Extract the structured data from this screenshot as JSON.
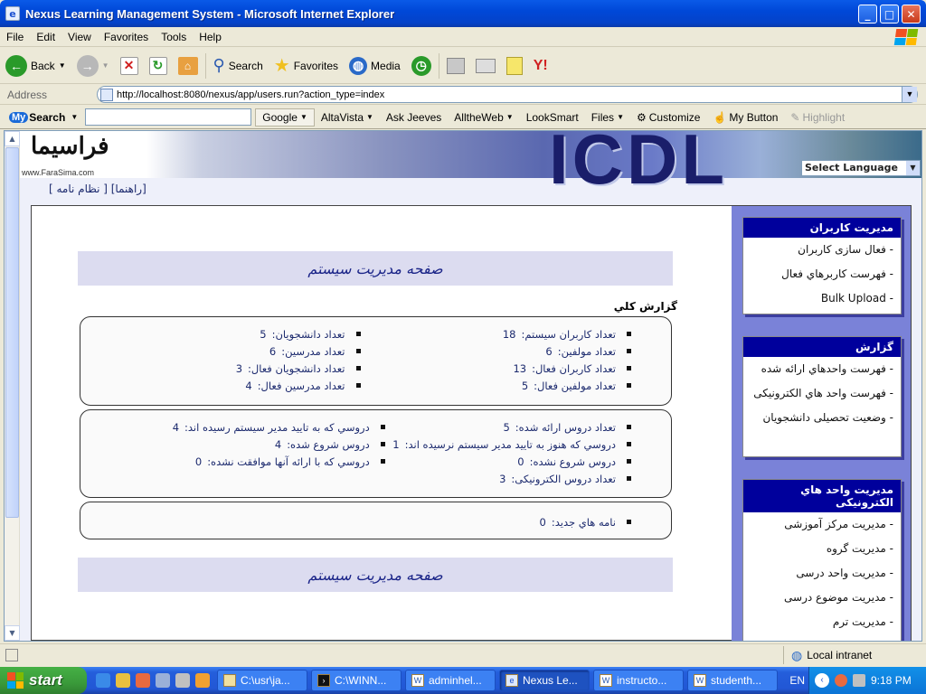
{
  "window": {
    "title": "Nexus Learning Management System - Microsoft Internet Explorer"
  },
  "menu": [
    "File",
    "Edit",
    "View",
    "Favorites",
    "Tools",
    "Help"
  ],
  "toolbar": {
    "back": "Back",
    "search": "Search",
    "favorites": "Favorites",
    "media": "Media"
  },
  "address": {
    "label": "Address",
    "url": "http://localhost:8080/nexus/app/users.run?action_type=index",
    "go": "Go"
  },
  "mysearch": {
    "logo_my": "My",
    "logo_search": "Search",
    "items": [
      "Google",
      "AltaVista",
      "Ask Jeeves",
      "AlltheWeb",
      "LookSmart",
      "Files",
      "Customize",
      "My Button",
      "Highlight"
    ]
  },
  "banner": {
    "logo_fa": "فراسيما",
    "site": "www.FaraSima.com",
    "brand": "ICDL",
    "language_select": "Select Language"
  },
  "top_links": "[راهنما] [ نظام نامه ]",
  "sidebar": [
    {
      "title": "مديريت کاربران",
      "items": [
        "- فعال سازی کاربران",
        "- فهرست کاربرهاي فعال",
        "- Bulk Upload"
      ]
    },
    {
      "title": "گزارش",
      "items": [
        "- فهرست واحدهاي ارائه شده",
        "- فهرست واحد هاي الکترونيکی",
        "- وضعيت تحصيلی دانشجويان"
      ]
    },
    {
      "title": "مديريت واحد هاي الکترونيکی",
      "items": [
        "- مديريت مرکز آموزشی",
        "- مديريت گروه",
        "- مديريت واحد درسی",
        "- مديريت موضوع درسی",
        "- مديريت ترم"
      ]
    }
  ],
  "main": {
    "header": "صفحه مديريت سيستم",
    "report_title": "گزارش کلي",
    "box1": [
      {
        "label": "تعداد کاربران سيستم:",
        "value": "18"
      },
      {
        "label": "تعداد دانشجويان:",
        "value": "5"
      },
      {
        "label": "تعداد مولفين:",
        "value": "6"
      },
      {
        "label": "تعداد مدرسين:",
        "value": "6"
      },
      {
        "label": "تعداد کاربران فعال:",
        "value": "13"
      },
      {
        "label": "تعداد دانشجويان فعال:",
        "value": "3"
      },
      {
        "label": "تعداد مولفين فعال:",
        "value": "5"
      },
      {
        "label": "تعداد مدرسين فعال:",
        "value": "4"
      }
    ],
    "box2": [
      {
        "label": "تعداد دروس ارائه شده:",
        "value": "5"
      },
      {
        "label": "دروسي که به تاييد مدير سيستم رسيده اند:",
        "value": "4"
      },
      {
        "label": "دروسي که هنوز به تاييد مدير سيستم نرسيده اند:",
        "value": "1"
      },
      {
        "label": "دروس شروع شده:",
        "value": "4"
      },
      {
        "label": "دروس شروع نشده:",
        "value": "0"
      },
      {
        "label": "دروسي که با ارائه آنها موافقت نشده:",
        "value": "0"
      },
      {
        "label": "تعداد دروس الکترونيکی:",
        "value": "3"
      }
    ],
    "box3": [
      {
        "label": "نامه هاي جديد:",
        "value": "0"
      }
    ],
    "footer": "صفحه مديريت سيستم"
  },
  "status": {
    "zone": "Local intranet"
  },
  "taskbar": {
    "start": "start",
    "buttons": [
      "C:\\usr\\ja...",
      "C:\\WINN...",
      "adminhel...",
      "Nexus Le...",
      "instructo...",
      "studenth..."
    ],
    "active": 3,
    "lang": "EN",
    "clock": "9:18 PM"
  }
}
